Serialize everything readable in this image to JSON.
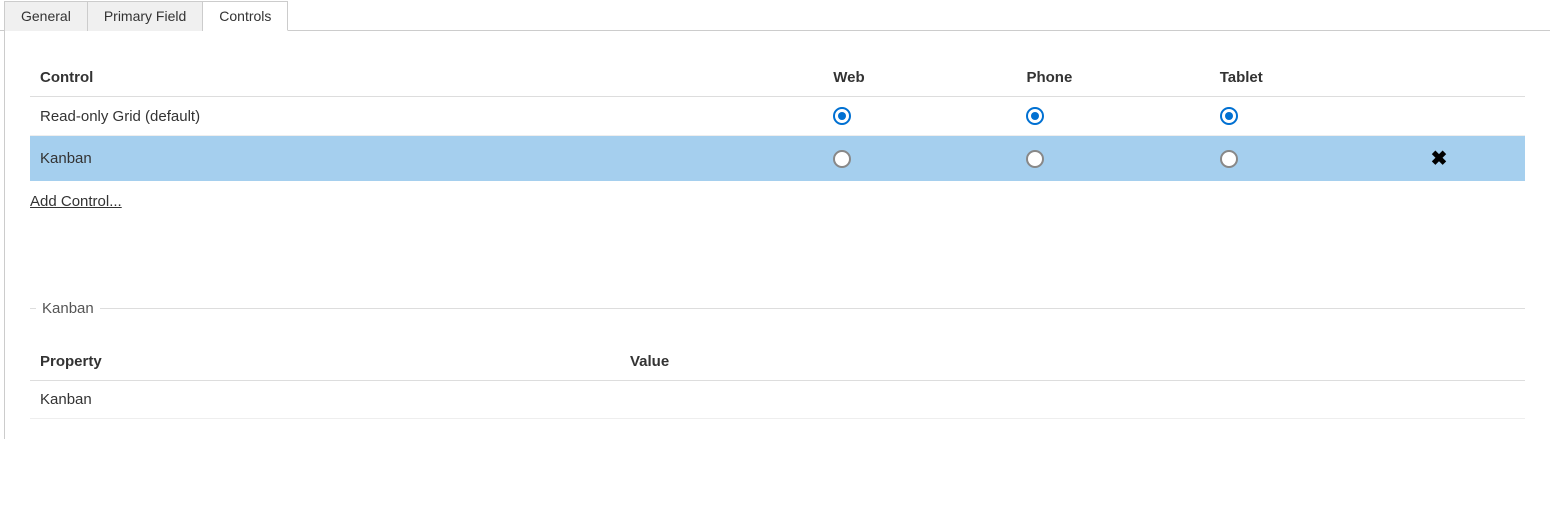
{
  "tabs": [
    {
      "label": "General",
      "active": false
    },
    {
      "label": "Primary Field",
      "active": false
    },
    {
      "label": "Controls",
      "active": true
    }
  ],
  "controls": {
    "headers": {
      "control": "Control",
      "web": "Web",
      "phone": "Phone",
      "tablet": "Tablet"
    },
    "rows": [
      {
        "name": "Read-only Grid (default)",
        "web": true,
        "phone": true,
        "tablet": true,
        "selected": false,
        "deletable": false
      },
      {
        "name": "Kanban",
        "web": false,
        "phone": false,
        "tablet": false,
        "selected": true,
        "deletable": true
      }
    ],
    "add_link": "Add Control..."
  },
  "details": {
    "legend": "Kanban",
    "headers": {
      "property": "Property",
      "value": "Value"
    },
    "rows": [
      {
        "property": "Kanban",
        "value": ""
      }
    ]
  }
}
